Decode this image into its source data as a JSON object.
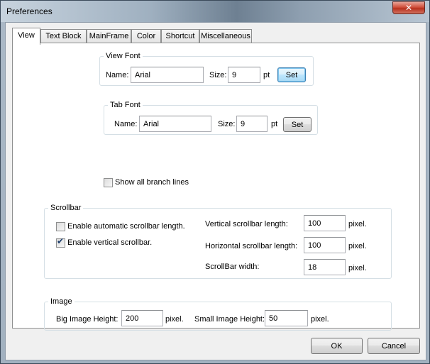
{
  "window": {
    "title": "Preferences",
    "close_glyph": "✕"
  },
  "tabs": [
    "View",
    "Text Block",
    "MainFrame",
    "Color",
    "Shortcut",
    "Miscellaneous"
  ],
  "view_font": {
    "legend": "View Font",
    "name_label": "Name:",
    "name_value": "Arial",
    "size_label": "Size:",
    "size_value": "9",
    "unit": "pt",
    "set_label": "Set"
  },
  "tab_font": {
    "legend": "Tab Font",
    "name_label": "Name:",
    "name_value": "Arial",
    "size_label": "Size:",
    "size_value": "9",
    "unit": "pt",
    "set_label": "Set"
  },
  "show_branch_lines": {
    "label": "Show all branch lines",
    "checked": false
  },
  "scrollbar": {
    "legend": "Scrollbar",
    "auto_length": {
      "label": "Enable automatic scrollbar length.",
      "checked": false
    },
    "vertical": {
      "label": "Enable vertical scrollbar.",
      "checked": true
    },
    "vertical_length": {
      "label": "Vertical scrollbar length:",
      "value": "100",
      "unit": "pixel."
    },
    "horizontal_length": {
      "label": "Horizontal scrollbar length:",
      "value": "100",
      "unit": "pixel."
    },
    "width": {
      "label": "ScrollBar width:",
      "value": "18",
      "unit": "pixel."
    }
  },
  "image": {
    "legend": "Image",
    "big_height": {
      "label": "Big Image Height:",
      "value": "200",
      "unit": "pixel."
    },
    "small_height": {
      "label": "Small Image Height:",
      "value": "50",
      "unit": "pixel."
    }
  },
  "footer": {
    "ok_label": "OK",
    "cancel_label": "Cancel"
  }
}
